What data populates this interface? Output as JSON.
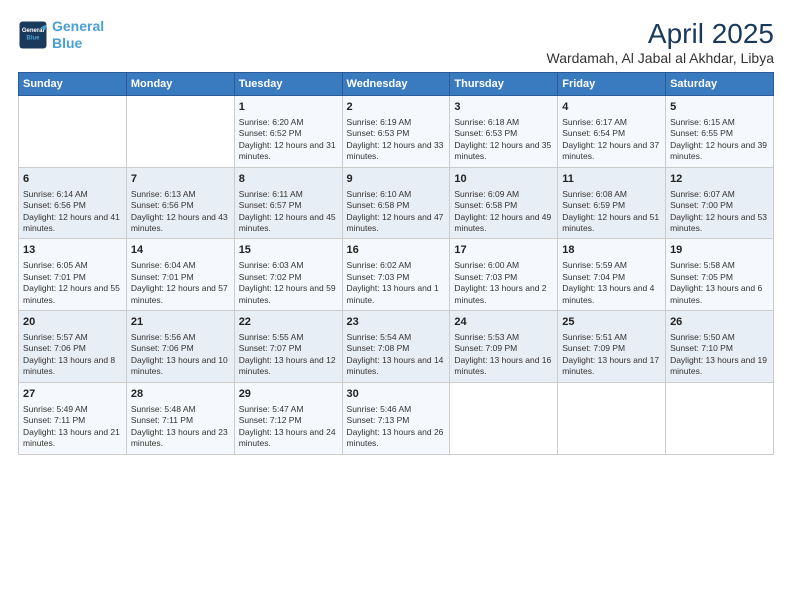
{
  "header": {
    "logo_line1": "General",
    "logo_line2": "Blue",
    "main_title": "April 2025",
    "subtitle": "Wardamah, Al Jabal al Akhdar, Libya"
  },
  "days_of_week": [
    "Sunday",
    "Monday",
    "Tuesday",
    "Wednesday",
    "Thursday",
    "Friday",
    "Saturday"
  ],
  "weeks": [
    [
      {
        "day": "",
        "info": ""
      },
      {
        "day": "",
        "info": ""
      },
      {
        "day": "1",
        "info": "Sunrise: 6:20 AM\nSunset: 6:52 PM\nDaylight: 12 hours and 31 minutes."
      },
      {
        "day": "2",
        "info": "Sunrise: 6:19 AM\nSunset: 6:53 PM\nDaylight: 12 hours and 33 minutes."
      },
      {
        "day": "3",
        "info": "Sunrise: 6:18 AM\nSunset: 6:53 PM\nDaylight: 12 hours and 35 minutes."
      },
      {
        "day": "4",
        "info": "Sunrise: 6:17 AM\nSunset: 6:54 PM\nDaylight: 12 hours and 37 minutes."
      },
      {
        "day": "5",
        "info": "Sunrise: 6:15 AM\nSunset: 6:55 PM\nDaylight: 12 hours and 39 minutes."
      }
    ],
    [
      {
        "day": "6",
        "info": "Sunrise: 6:14 AM\nSunset: 6:56 PM\nDaylight: 12 hours and 41 minutes."
      },
      {
        "day": "7",
        "info": "Sunrise: 6:13 AM\nSunset: 6:56 PM\nDaylight: 12 hours and 43 minutes."
      },
      {
        "day": "8",
        "info": "Sunrise: 6:11 AM\nSunset: 6:57 PM\nDaylight: 12 hours and 45 minutes."
      },
      {
        "day": "9",
        "info": "Sunrise: 6:10 AM\nSunset: 6:58 PM\nDaylight: 12 hours and 47 minutes."
      },
      {
        "day": "10",
        "info": "Sunrise: 6:09 AM\nSunset: 6:58 PM\nDaylight: 12 hours and 49 minutes."
      },
      {
        "day": "11",
        "info": "Sunrise: 6:08 AM\nSunset: 6:59 PM\nDaylight: 12 hours and 51 minutes."
      },
      {
        "day": "12",
        "info": "Sunrise: 6:07 AM\nSunset: 7:00 PM\nDaylight: 12 hours and 53 minutes."
      }
    ],
    [
      {
        "day": "13",
        "info": "Sunrise: 6:05 AM\nSunset: 7:01 PM\nDaylight: 12 hours and 55 minutes."
      },
      {
        "day": "14",
        "info": "Sunrise: 6:04 AM\nSunset: 7:01 PM\nDaylight: 12 hours and 57 minutes."
      },
      {
        "day": "15",
        "info": "Sunrise: 6:03 AM\nSunset: 7:02 PM\nDaylight: 12 hours and 59 minutes."
      },
      {
        "day": "16",
        "info": "Sunrise: 6:02 AM\nSunset: 7:03 PM\nDaylight: 13 hours and 1 minute."
      },
      {
        "day": "17",
        "info": "Sunrise: 6:00 AM\nSunset: 7:03 PM\nDaylight: 13 hours and 2 minutes."
      },
      {
        "day": "18",
        "info": "Sunrise: 5:59 AM\nSunset: 7:04 PM\nDaylight: 13 hours and 4 minutes."
      },
      {
        "day": "19",
        "info": "Sunrise: 5:58 AM\nSunset: 7:05 PM\nDaylight: 13 hours and 6 minutes."
      }
    ],
    [
      {
        "day": "20",
        "info": "Sunrise: 5:57 AM\nSunset: 7:06 PM\nDaylight: 13 hours and 8 minutes."
      },
      {
        "day": "21",
        "info": "Sunrise: 5:56 AM\nSunset: 7:06 PM\nDaylight: 13 hours and 10 minutes."
      },
      {
        "day": "22",
        "info": "Sunrise: 5:55 AM\nSunset: 7:07 PM\nDaylight: 13 hours and 12 minutes."
      },
      {
        "day": "23",
        "info": "Sunrise: 5:54 AM\nSunset: 7:08 PM\nDaylight: 13 hours and 14 minutes."
      },
      {
        "day": "24",
        "info": "Sunrise: 5:53 AM\nSunset: 7:09 PM\nDaylight: 13 hours and 16 minutes."
      },
      {
        "day": "25",
        "info": "Sunrise: 5:51 AM\nSunset: 7:09 PM\nDaylight: 13 hours and 17 minutes."
      },
      {
        "day": "26",
        "info": "Sunrise: 5:50 AM\nSunset: 7:10 PM\nDaylight: 13 hours and 19 minutes."
      }
    ],
    [
      {
        "day": "27",
        "info": "Sunrise: 5:49 AM\nSunset: 7:11 PM\nDaylight: 13 hours and 21 minutes."
      },
      {
        "day": "28",
        "info": "Sunrise: 5:48 AM\nSunset: 7:11 PM\nDaylight: 13 hours and 23 minutes."
      },
      {
        "day": "29",
        "info": "Sunrise: 5:47 AM\nSunset: 7:12 PM\nDaylight: 13 hours and 24 minutes."
      },
      {
        "day": "30",
        "info": "Sunrise: 5:46 AM\nSunset: 7:13 PM\nDaylight: 13 hours and 26 minutes."
      },
      {
        "day": "",
        "info": ""
      },
      {
        "day": "",
        "info": ""
      },
      {
        "day": "",
        "info": ""
      }
    ]
  ]
}
